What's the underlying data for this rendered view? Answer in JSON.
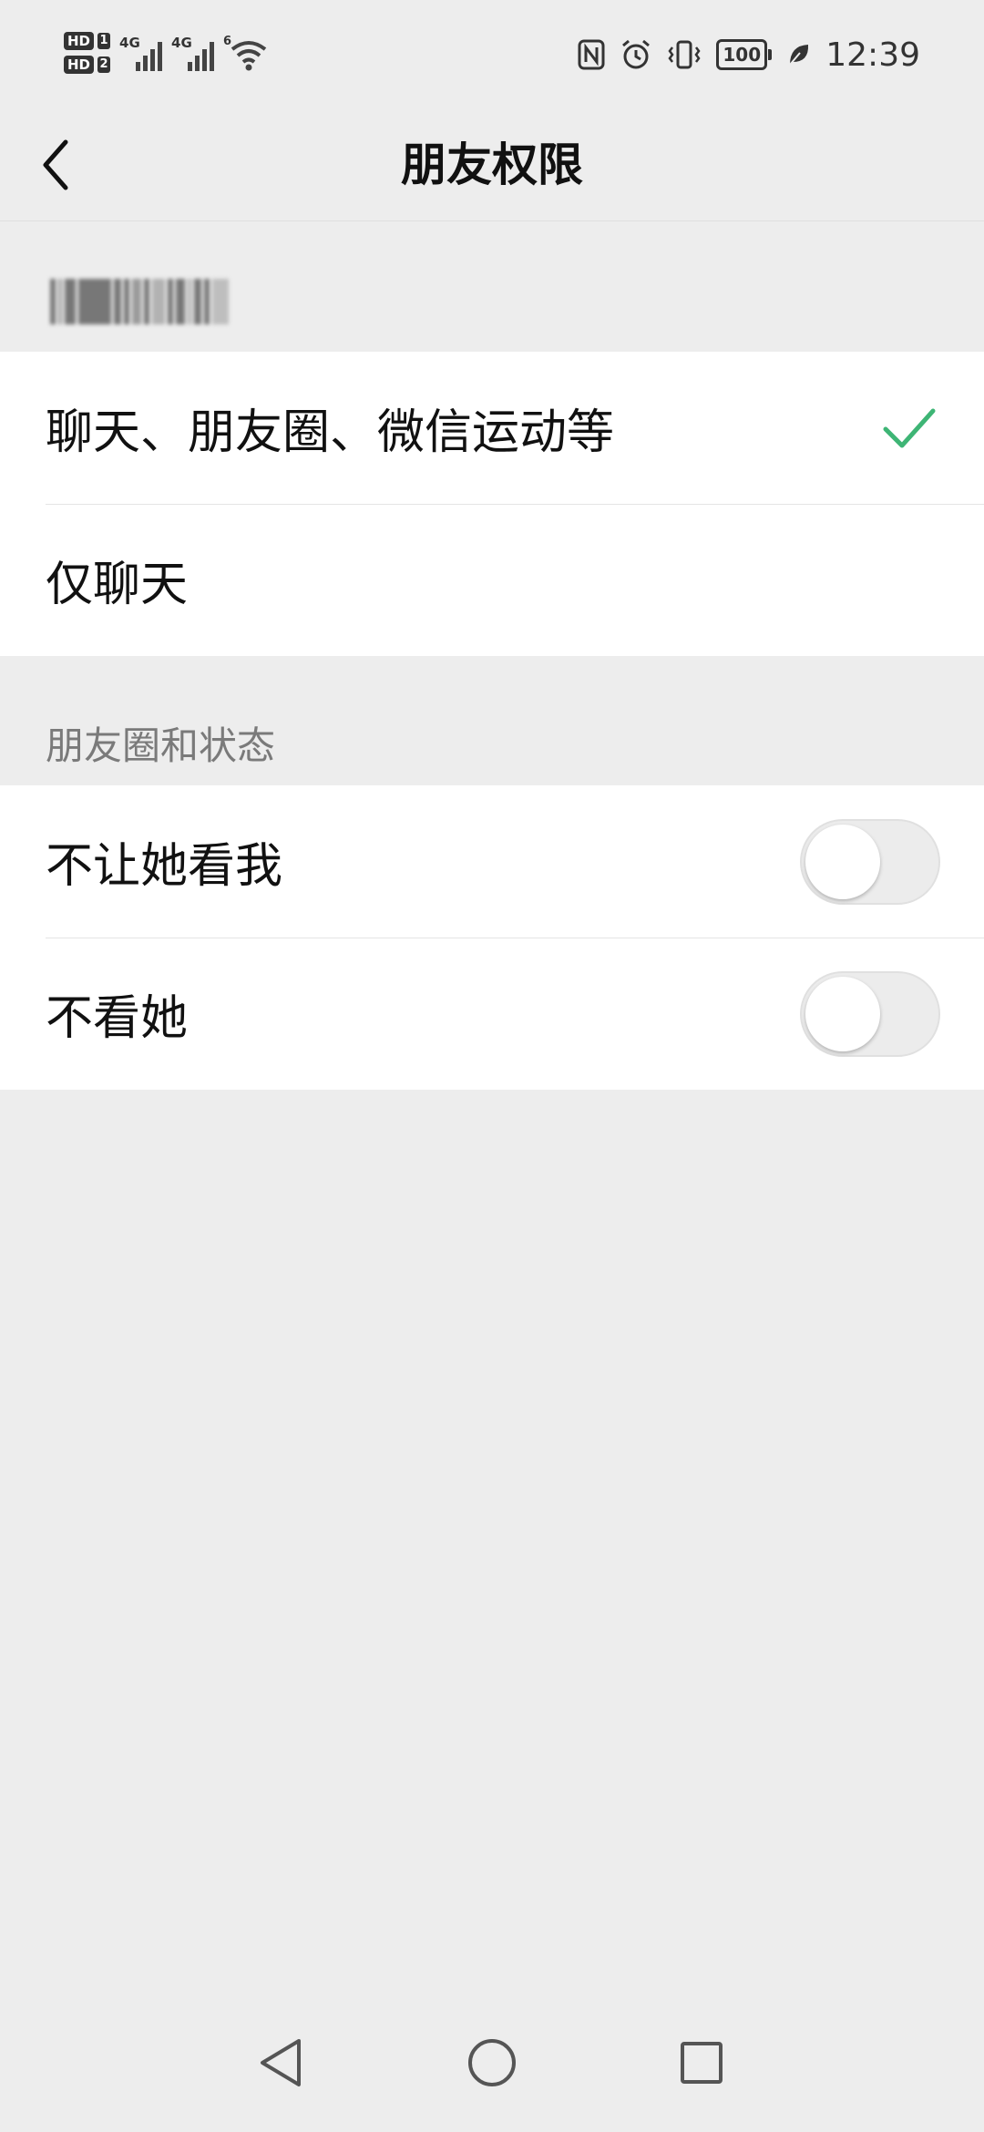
{
  "status_bar": {
    "hd_badge": "HD",
    "sim1": "1",
    "sim2": "2",
    "network1": "4G",
    "network2": "4G",
    "wifi_badge": "6",
    "battery": "100",
    "time": "12:39",
    "icons": [
      "nfc-icon",
      "alarm-icon",
      "vibrate-icon",
      "battery-icon",
      "leaf-icon"
    ]
  },
  "nav": {
    "title": "朋友权限",
    "back_icon": "chevron-left-icon"
  },
  "permission_options": [
    {
      "label": "聊天、朋友圈、微信运动等",
      "selected": true
    },
    {
      "label": "仅聊天",
      "selected": false
    }
  ],
  "moments_section": {
    "title": "朋友圈和状态",
    "toggles": [
      {
        "label": "不让她看我",
        "on": false
      },
      {
        "label": "不看她",
        "on": false
      }
    ]
  },
  "system_nav": [
    "back-triangle-icon",
    "home-circle-icon",
    "recents-square-icon"
  ],
  "colors": {
    "background": "#ededed",
    "card": "#ffffff",
    "accent_check": "#3eb575",
    "section_text": "#7a7a7a"
  }
}
